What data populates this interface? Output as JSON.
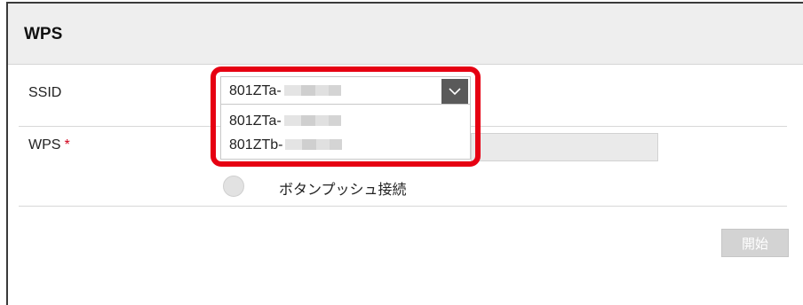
{
  "panel": {
    "title": "WPS"
  },
  "ssid": {
    "label": "SSID",
    "selected_prefix": "801ZTa-",
    "options": [
      {
        "prefix": "801ZTa-"
      },
      {
        "prefix": "801ZTb-"
      }
    ]
  },
  "wps": {
    "label": "WPS",
    "required_mark": "*",
    "radio_label": "ボタンプッシュ接続"
  },
  "actions": {
    "start_label": "開始"
  },
  "colors": {
    "highlight": "#e60012",
    "header_bg": "#eeeeee",
    "arrow_bg": "#5a5a5a",
    "button_disabled": "#d3d3d3",
    "required": "#d0021b"
  },
  "icons": {
    "select_arrow": "chevron-down-icon"
  }
}
